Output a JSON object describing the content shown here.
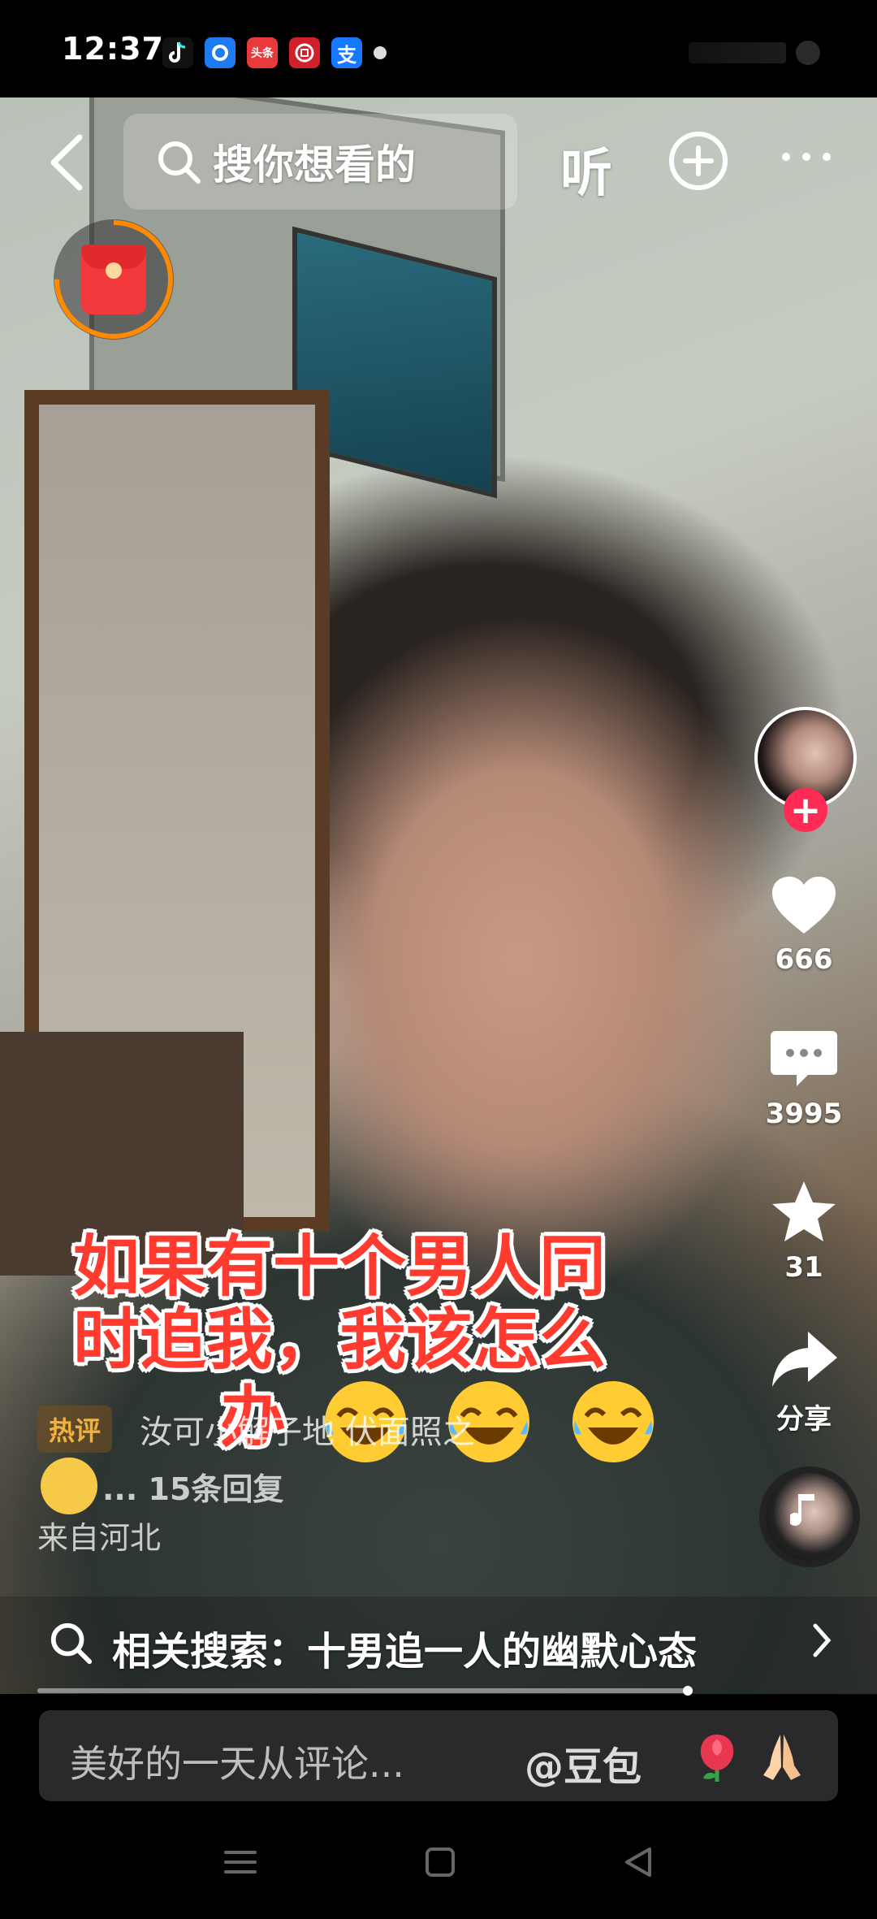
{
  "status_bar": {
    "time": "12:37",
    "apps": [
      {
        "name": "tiktok-icon",
        "label": "",
        "color": "#000000"
      },
      {
        "name": "blue-app-icon",
        "label": "",
        "color": "#1e7cf2"
      },
      {
        "name": "toutiao-icon",
        "label": "头条",
        "color": "#e8393c"
      },
      {
        "name": "bank-icon",
        "label": "",
        "color": "#d0202a"
      },
      {
        "name": "alipay-icon",
        "label": "支",
        "color": "#1677ff"
      }
    ]
  },
  "top_bar": {
    "search_placeholder": "搜你想看的",
    "listen_label": "听"
  },
  "right_rail": {
    "likes": "666",
    "comments": "3995",
    "favorites": "31",
    "share_label": "分享"
  },
  "caption": {
    "line1": "如果有十个男人同",
    "line2": "时追我，我该怎么",
    "line3": "办"
  },
  "hot_comment": {
    "badge": "热评",
    "text": "汝可小解子地 伏面照之",
    "count": "... 15条回复",
    "location": "来自河北"
  },
  "related_search": {
    "text": "相关搜索：十男追一人的幽默心态"
  },
  "progress": 0.73,
  "comment_input": {
    "placeholder": "美好的一天从评论...",
    "mention": "@豆包"
  },
  "colors": {
    "accent": "#fe2c55",
    "caption": "#ff3b30",
    "ring": "#ff8a00"
  }
}
